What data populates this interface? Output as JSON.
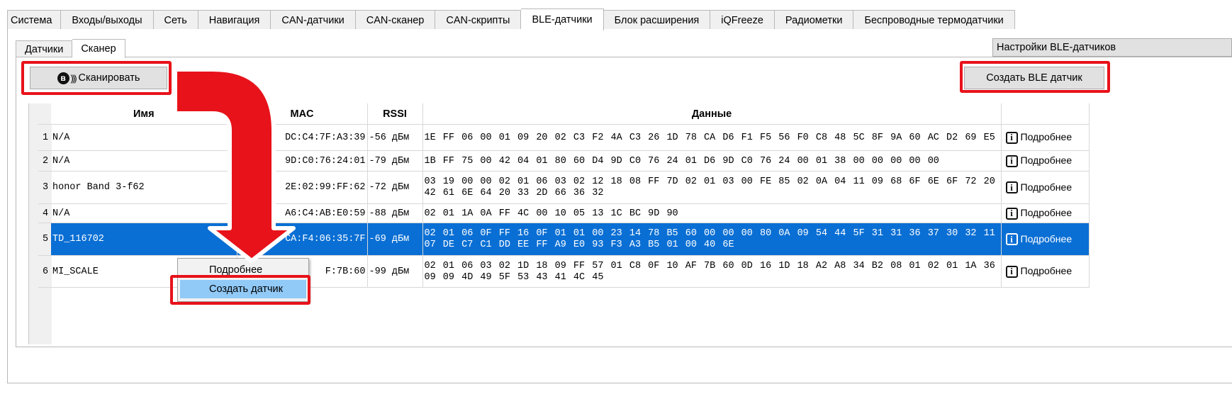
{
  "top_tabs": [
    "Система",
    "Входы/выходы",
    "Сеть",
    "Навигация",
    "CAN-датчики",
    "CAN-сканер",
    "CAN-скрипты",
    "BLE-датчики",
    "Блок расширения",
    "iQFreeze",
    "Радиометки",
    "Беспроводные термодатчики"
  ],
  "active_top_tab": "BLE-датчики",
  "sub_tabs": [
    "Датчики",
    "Сканер"
  ],
  "active_sub_tab": "Сканер",
  "settings_label": "Настройки BLE-датчиков",
  "scan_label": "Сканировать",
  "create_label": "Создать BLE датчик",
  "table": {
    "headers": {
      "name": "Имя",
      "mac": "MAC",
      "rssi": "RSSI",
      "data": "Данные"
    },
    "details_label": "Подробнее",
    "rows": [
      {
        "num": "1",
        "name": "N/A",
        "mac": "DC:C4:7F:A3:39",
        "rssi": "-56 дБм",
        "data": "1E FF 06 00 01 09 20 02 C3 F2 4A C3 26 1D 78 CA D6 F1 F5 56 F0 C8 48 5C 8F 9A 60 AC D2 69 E5"
      },
      {
        "num": "2",
        "name": "N/A",
        "mac": "9D:C0:76:24:01",
        "rssi": "-79 дБм",
        "data": "1B FF 75 00 42 04 01 80 60 D4 9D C0 76 24 01 D6 9D C0 76 24 00 01 38 00 00 00 00 00"
      },
      {
        "num": "3",
        "name": "honor Band 3-f62",
        "mac": "2E:02:99:FF:62",
        "rssi": "-72 дБм",
        "data": "03 19 00 00 02 01 06 03 02 12 18 08 FF 7D 02 01 03 00 FE 85 02 0A 04 11 09 68 6F 6E 6F 72 20 42 61 6E 64 20 33 2D 66 36 32"
      },
      {
        "num": "4",
        "name": "N/A",
        "mac": "A6:C4:AB:E0:59",
        "rssi": "-88 дБм",
        "data": "02 01 1A 0A FF 4C 00 10 05 13 1C BC 9D 90"
      },
      {
        "num": "5",
        "name": "TD_116702",
        "mac": "CA:F4:06:35:7F",
        "rssi": "-69 дБм",
        "data": "02 01 06 0F FF 16 0F 01 01 00 23 14 78 B5 60 00 00 00 80 0A 09 54 44 5F 31 31 36 37 30 32 11 07 DE C7 C1 DD EE FF A9 E0 93 F3 A3 B5 01 00 40 6E"
      },
      {
        "num": "6",
        "name": "MI_SCALE",
        "mac": "F:7B:60",
        "rssi": "-99 дБм",
        "data": "02 01 06 03 02 1D 18 09 FF 57 01 C8 0F 10 AF 7B 60 0D 16 1D 18 A2 A8 34 B2 08 01 02 01 1A 36 09 09 4D 49 5F 53 43 41 4C 45"
      }
    ],
    "selected_row": "5"
  },
  "context_menu": {
    "details": "Подробнее",
    "create": "Создать датчик"
  },
  "colors": {
    "selection": "#0a6fd4",
    "highlight": "#e8121a",
    "menu_hover": "#91c9f7"
  }
}
